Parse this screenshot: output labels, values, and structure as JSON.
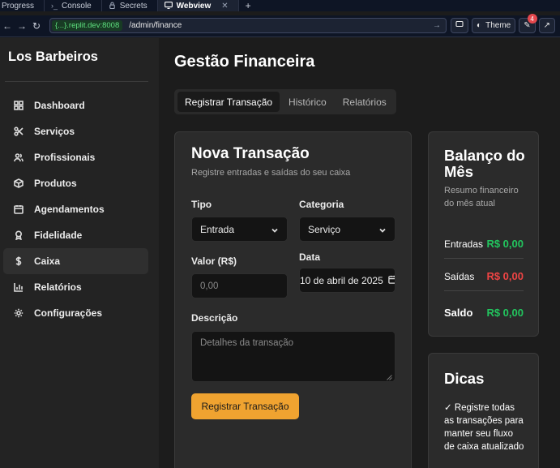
{
  "browser": {
    "tabs": [
      {
        "label": "Progress",
        "icon": "progress-icon"
      },
      {
        "label": "Console",
        "icon": "console-icon"
      },
      {
        "label": "Secrets",
        "icon": "lock-icon"
      },
      {
        "label": "Webview",
        "icon": "monitor-icon",
        "active": true
      }
    ],
    "url_host": "{...}.replit.dev:8008",
    "url_path": "/admin/finance",
    "theme_label": "Theme",
    "notification_count": "4"
  },
  "sidebar": {
    "brand": "Los Barbeiros",
    "items": [
      {
        "label": "Dashboard",
        "icon": "grid-icon"
      },
      {
        "label": "Serviços",
        "icon": "scissors-icon"
      },
      {
        "label": "Profissionais",
        "icon": "users-icon"
      },
      {
        "label": "Produtos",
        "icon": "package-icon"
      },
      {
        "label": "Agendamentos",
        "icon": "calendar-icon"
      },
      {
        "label": "Fidelidade",
        "icon": "award-icon"
      },
      {
        "label": "Caixa",
        "icon": "dollar-icon",
        "active": true
      },
      {
        "label": "Relatórios",
        "icon": "bar-chart-icon"
      },
      {
        "label": "Configurações",
        "icon": "gear-icon"
      }
    ]
  },
  "page": {
    "title": "Gestão Financeira",
    "tabs": [
      "Registrar Transação",
      "Histórico",
      "Relatórios"
    ]
  },
  "form": {
    "title": "Nova Transação",
    "subtitle": "Registre entradas e saídas do seu caixa",
    "tipo_label": "Tipo",
    "tipo_value": "Entrada",
    "categoria_label": "Categoria",
    "categoria_value": "Serviço",
    "valor_label": "Valor (R$)",
    "valor_placeholder": "0,00",
    "data_label": "Data",
    "data_value": "10 de abril de 2025",
    "descricao_label": "Descrição",
    "descricao_placeholder": "Detalhes da transação",
    "submit_label": "Registrar Transação"
  },
  "balance": {
    "title": "Balanço do Mês",
    "subtitle": "Resumo financeiro do mês atual",
    "entradas_label": "Entradas",
    "entradas_value": "R$ 0,00",
    "saidas_label": "Saídas",
    "saidas_value": "R$ 0,00",
    "saldo_label": "Saldo",
    "saldo_value": "R$ 0,00"
  },
  "tips": {
    "title": "Dicas",
    "text": "✓ Registre todas as transações para manter seu fluxo de caixa atualizado"
  },
  "colors": {
    "accent": "#f0a330",
    "positive": "#22c55e",
    "negative": "#ef4444",
    "background": "#1c1c1c",
    "card": "#2b2b2b"
  }
}
